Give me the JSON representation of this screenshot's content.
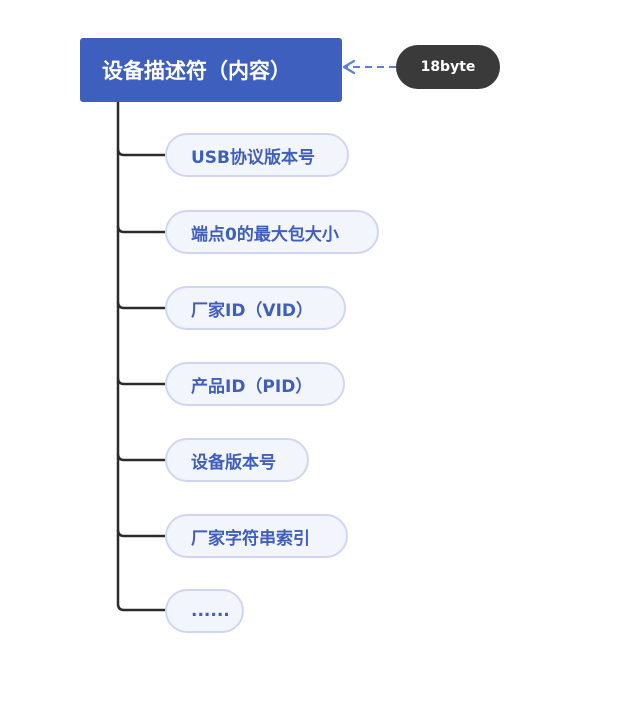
{
  "root": {
    "label": "设备描述符（内容）"
  },
  "note": {
    "label": "18byte"
  },
  "children": [
    {
      "label": "USB协议版本号"
    },
    {
      "label": "端点0的最大包大小"
    },
    {
      "label": "厂家ID（VID）"
    },
    {
      "label": "产品ID（PID）"
    },
    {
      "label": "设备版本号"
    },
    {
      "label": "厂家字符串索引"
    },
    {
      "label": "......"
    }
  ],
  "colors": {
    "root_fill": "#3f5fbf",
    "note_fill": "#3a3a3a",
    "child_fill": "#f3f5fd",
    "child_border": "#cfd6f3",
    "child_text": "#3f5fbf",
    "connector": "#2b2b2b",
    "dashed_arrow": "#5b7fe0"
  }
}
